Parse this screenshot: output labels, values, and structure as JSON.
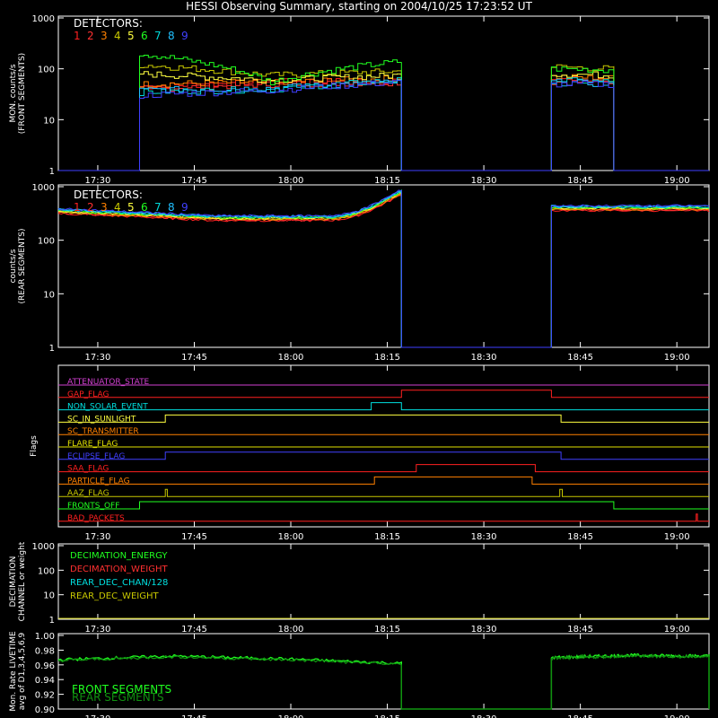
{
  "title": "HESSI Observing Summary, starting on 2004/10/25 17:23:52 UT",
  "x_axis": {
    "tick_labels": [
      "17:30",
      "17:45",
      "18:00",
      "18:15",
      "18:30",
      "18:45",
      "19:00"
    ],
    "tick_minutes": [
      30,
      45,
      60,
      75,
      90,
      105,
      120
    ],
    "range_minutes": [
      23.87,
      125
    ]
  },
  "detector_colors": [
    "#ff2020",
    "#ff3030",
    "#ff8000",
    "#c8c800",
    "#ffff40",
    "#20ff20",
    "#00d8d8",
    "#20c0ff",
    "#4040ff"
  ],
  "chart_data": [
    {
      "type": "line",
      "panel": "front",
      "ylabel": [
        "MON. counts/s",
        "(FRONT SEGMENTS)"
      ],
      "ylim": [
        1,
        1000
      ],
      "yscale": "log",
      "y_tick_labels": [
        "1",
        "10",
        "100",
        "1000"
      ],
      "legend": {
        "title": "DETECTORS:",
        "entries": [
          "1",
          "2",
          "3",
          "4",
          "5",
          "6",
          "7",
          "8",
          "9"
        ]
      },
      "segments": [
        {
          "start": 36.5,
          "end": 77.2
        },
        {
          "start": 100.5,
          "end": 110.2
        }
      ],
      "series": [
        {
          "name": "1",
          "values_seg1": [
            45,
            55,
            60
          ],
          "values_seg2": [
            65,
            60
          ]
        },
        {
          "name": "2",
          "values_seg1": [
            40,
            50,
            55
          ],
          "values_seg2": [
            55,
            55
          ]
        },
        {
          "name": "3",
          "values_seg1": [
            50,
            55,
            65
          ],
          "values_seg2": [
            70,
            65
          ]
        },
        {
          "name": "4",
          "values_seg1": [
            120,
            75,
            90
          ],
          "values_seg2": [
            110,
            100
          ]
        },
        {
          "name": "5",
          "values_seg1": [
            80,
            60,
            75
          ],
          "values_seg2": [
            80,
            75
          ]
        },
        {
          "name": "6",
          "values_seg1": [
            200,
            55,
            140
          ],
          "values_seg2": [
            100,
            95
          ]
        },
        {
          "name": "7",
          "values_seg1": [
            35,
            40,
            60
          ],
          "values_seg2": [
            60,
            55
          ]
        },
        {
          "name": "8",
          "values_seg1": [
            38,
            42,
            55
          ],
          "values_seg2": [
            55,
            50
          ]
        },
        {
          "name": "9",
          "values_seg1": [
            30,
            38,
            55
          ],
          "values_seg2": [
            50,
            50
          ]
        }
      ]
    },
    {
      "type": "line",
      "panel": "rear",
      "ylabel": [
        "counts/s",
        "(REAR SEGMENTS)"
      ],
      "ylim": [
        1,
        1000
      ],
      "yscale": "log",
      "y_tick_labels": [
        "1",
        "10",
        "100",
        "1000"
      ],
      "legend": {
        "title": "DETECTORS:",
        "entries": [
          "1",
          "2",
          "3",
          "4",
          "5",
          "6",
          "7",
          "8",
          "9"
        ]
      },
      "segments": [
        {
          "start": 23.87,
          "end": 77.2
        },
        {
          "start": 100.5,
          "end": 125
        }
      ],
      "approx_values": {
        "start": 350,
        "mid": 260,
        "end_seg1": 800,
        "seg2": 400
      }
    },
    {
      "type": "flags",
      "panel": "flags",
      "ylabel": "Flags",
      "flags": [
        {
          "name": "ATTENUATOR_STATE",
          "color": "#d040d0",
          "changes": []
        },
        {
          "name": "GAP_FLAG",
          "color": "#ff2020",
          "changes": [
            77.2,
            100.5
          ]
        },
        {
          "name": "NON_SOLAR_EVENT",
          "color": "#00e0e0",
          "changes": [
            72.5,
            77.2
          ]
        },
        {
          "name": "SC_IN_SUNLIGHT",
          "color": "#ffff40",
          "changes": [
            40.5,
            102.0
          ]
        },
        {
          "name": "SC_TRANSMITTER",
          "color": "#ff8000",
          "changes": []
        },
        {
          "name": "FLARE_FLAG",
          "color": "#e0e000",
          "changes": []
        },
        {
          "name": "ECLIPSE_FLAG",
          "color": "#4040ff",
          "changes": [
            40.5,
            102.0
          ]
        },
        {
          "name": "SAA_FLAG",
          "color": "#ff2020",
          "changes": [
            79.5,
            98.0
          ]
        },
        {
          "name": "PARTICLE_FLAG",
          "color": "#ff8000",
          "changes": [
            73.0,
            97.5
          ]
        },
        {
          "name": "AAZ_FLAG",
          "color": "#c8c800",
          "changes": [
            40.5,
            40.8,
            101.8,
            102.2
          ]
        },
        {
          "name": "FRONTS_OFF",
          "color": "#20ff20",
          "changes": [
            36.5,
            110.2
          ]
        },
        {
          "name": "BAD_PACKETS",
          "color": "#ff2020",
          "changes": [
            123.0,
            123.2
          ]
        }
      ]
    },
    {
      "type": "line",
      "panel": "decimation",
      "ylabel": [
        "DECIMATION",
        "CHANNEL or weight"
      ],
      "ylim": [
        1,
        1000
      ],
      "yscale": "log",
      "y_tick_labels": [
        "1",
        "10",
        "100",
        "1000"
      ],
      "legend": [
        {
          "name": "DECIMATION_ENERGY",
          "color": "#20ff20"
        },
        {
          "name": "DECIMATION_WEIGHT",
          "color": "#ff3030"
        },
        {
          "name": "REAR_DEC_CHAN/128",
          "color": "#00e0e0"
        },
        {
          "name": "REAR_DEC_WEIGHT",
          "color": "#c8c800"
        }
      ]
    },
    {
      "type": "line",
      "panel": "livetime",
      "ylabel": [
        "Mon. Rate LIVETIME",
        "avg of D1,3,4,5,6,9"
      ],
      "ylim": [
        0.9,
        1.0
      ],
      "y_tick_labels": [
        "0.90",
        "0.92",
        "0.94",
        "0.96",
        "0.98",
        "1.00"
      ],
      "series": [
        {
          "name": "FRONT SEGMENTS",
          "color": "#20ff20"
        },
        {
          "name": "REAR SEGMENTS",
          "color": "#109010"
        }
      ],
      "segments": [
        {
          "start": 23.87,
          "end": 77.2,
          "values": [
            0.967,
            0.972,
            0.968,
            0.962
          ]
        },
        {
          "start": 100.5,
          "end": 125,
          "values": [
            0.97,
            0.973,
            0.972
          ]
        }
      ]
    }
  ]
}
